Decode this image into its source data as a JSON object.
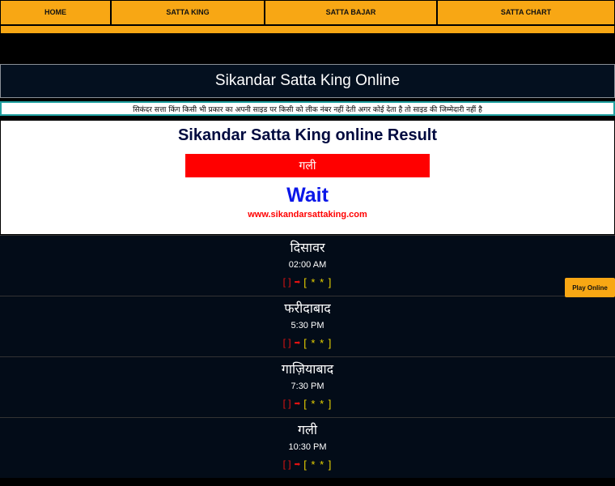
{
  "nav": {
    "items": [
      {
        "label": "HOME"
      },
      {
        "label": "SATTA KING"
      },
      {
        "label": "SATTA BAJAR"
      },
      {
        "label": "SATTA CHART"
      }
    ]
  },
  "header": {
    "title": "Sikandar Satta King Online"
  },
  "notice": {
    "text": "सिकंदर सत्ता किंग किसी भी प्रकार का अपनी साइड पर किसी को लीक नंबर नहीं देती अगर कोई देता है तो साइड की  जिम्मेदारी नहीं है"
  },
  "result": {
    "title": "Sikandar Satta King online Result",
    "game": "गली",
    "status": "Wait",
    "site": "www.sikandarsattaking.com"
  },
  "games": [
    {
      "name": "दिसावर",
      "time": "02:00 AM",
      "old": "[ ]",
      "arrow": "➡",
      "new": "[ * * ]"
    },
    {
      "name": "फरीदाबाद",
      "time": "5:30 PM",
      "old": "[ ]",
      "arrow": "➡",
      "new": "[ * * ]"
    },
    {
      "name": "गाज़ियाबाद",
      "time": "7:30 PM",
      "old": "[ ]",
      "arrow": "➡",
      "new": "[ * * ]"
    },
    {
      "name": "गली",
      "time": "10:30 PM",
      "old": "[ ]",
      "arrow": "➡",
      "new": "[ * * ]"
    }
  ],
  "play_button": {
    "label": "Play Online"
  },
  "colors": {
    "accent": "#f8a714",
    "panel": "#04101f",
    "red": "#ff0000",
    "wait_blue": "#0a16e8",
    "result_yellow": "#e7d100"
  }
}
